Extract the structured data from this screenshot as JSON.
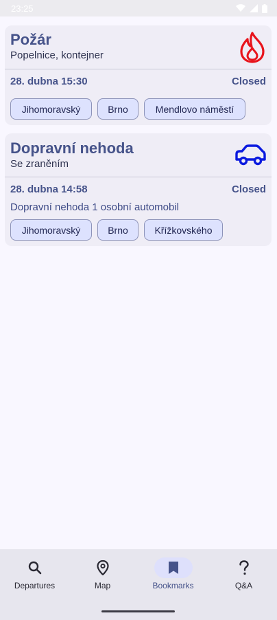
{
  "status_bar": {
    "time": "23:25"
  },
  "incidents": [
    {
      "title": "Požár",
      "subtitle": "Popelnice, kontejner",
      "icon": "fire-icon",
      "icon_color": "#e8141c",
      "date": "28. dubna 15:30",
      "status": "Closed",
      "description": "",
      "tags": [
        "Jihomoravský",
        "Brno",
        "Mendlovo náměstí"
      ]
    },
    {
      "title": "Dopravní nehoda",
      "subtitle": "Se zraněním",
      "icon": "car-icon",
      "icon_color": "#0b1adf",
      "date": "28. dubna 14:58",
      "status": "Closed",
      "description": "Dopravní nehoda 1 osobní automobil",
      "tags": [
        "Jihomoravský",
        "Brno",
        "Křížkovského"
      ]
    }
  ],
  "bottom_nav": {
    "active": "Bookmarks",
    "items": [
      {
        "label": "Departures",
        "icon": "search-icon"
      },
      {
        "label": "Map",
        "icon": "map-pin-icon"
      },
      {
        "label": "Bookmarks",
        "icon": "bookmark-icon"
      },
      {
        "label": "Q&A",
        "icon": "question-icon"
      }
    ]
  },
  "colors": {
    "accent": "#46538a",
    "card_background": "#efedf6",
    "chip_background": "#dde2fe",
    "active_nav_pill": "#dee0fc"
  }
}
